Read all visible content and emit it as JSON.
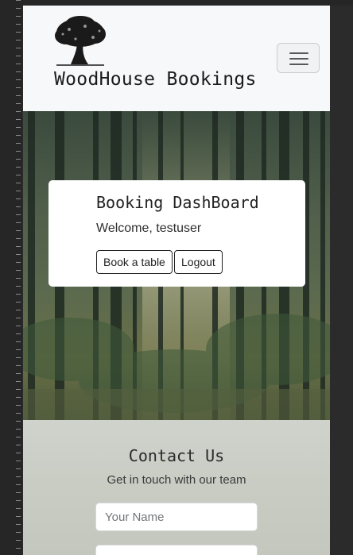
{
  "navbar": {
    "brand": "WoodHouse Bookings",
    "logo_icon": "tree-logo-icon",
    "menu_icon": "hamburger-menu-icon"
  },
  "dashboard": {
    "title": "Booking DashBoard",
    "welcome": "Welcome, testuser",
    "book_label": "Book a table",
    "logout_label": "Logout"
  },
  "contact": {
    "title": "Contact Us",
    "subtitle": "Get in touch with our team",
    "name_placeholder": "Your Name",
    "second_placeholder": ""
  },
  "colors": {
    "navbar_bg": "#f7f8fa",
    "card_bg": "#ffffff",
    "text_dark": "#222222"
  }
}
